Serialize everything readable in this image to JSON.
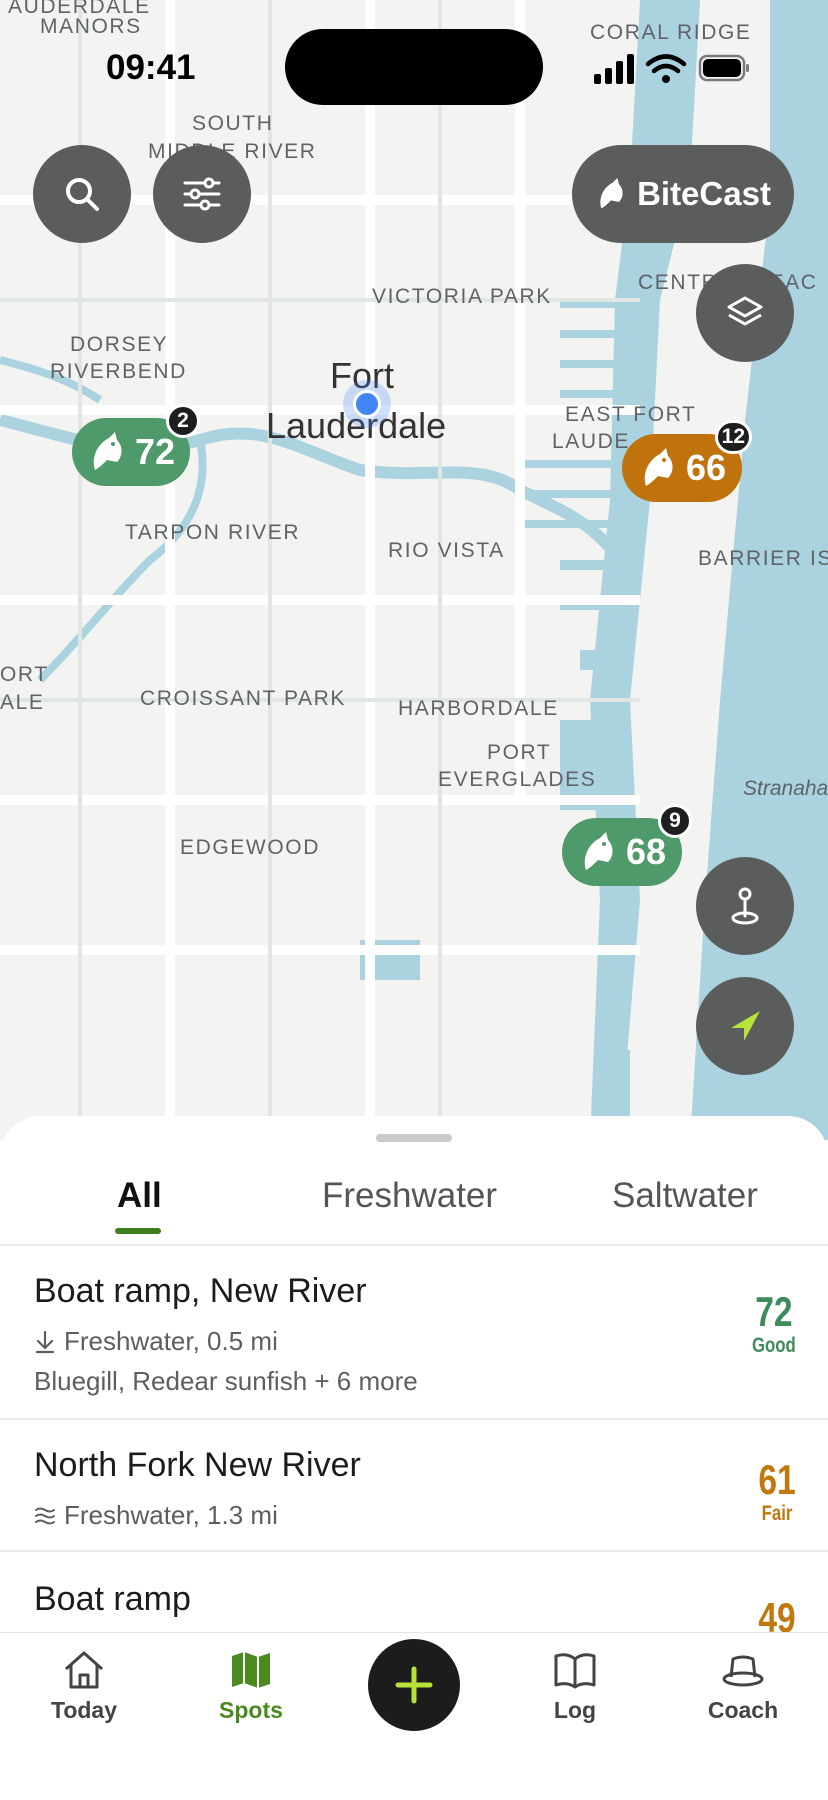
{
  "status": {
    "time": "09:41"
  },
  "map": {
    "labels": [
      {
        "text": "AUDERDALE",
        "cls": ""
      },
      {
        "text": "MANORS",
        "cls": ""
      },
      {
        "text": "SOUTH",
        "cls": ""
      },
      {
        "text": "MIDDLE RIVER",
        "cls": ""
      },
      {
        "text": "CORAL RIDGE",
        "cls": ""
      },
      {
        "text": "VICTORIA PARK",
        "cls": ""
      },
      {
        "text": "CENTRAL BEAC",
        "cls": ""
      },
      {
        "text": "DORSEY",
        "cls": ""
      },
      {
        "text": "RIVERBEND",
        "cls": ""
      },
      {
        "text": "Fort",
        "cls": "big"
      },
      {
        "text": "Lauderdale",
        "cls": "big"
      },
      {
        "text": "EAST FORT",
        "cls": ""
      },
      {
        "text": "LAUDE",
        "cls": ""
      },
      {
        "text": "TARPON RIVER",
        "cls": ""
      },
      {
        "text": "RIO VISTA",
        "cls": ""
      },
      {
        "text": "BARRIER IS",
        "cls": ""
      },
      {
        "text": "ORT",
        "cls": ""
      },
      {
        "text": "ALE",
        "cls": ""
      },
      {
        "text": "CROISSANT PARK",
        "cls": ""
      },
      {
        "text": "HARBORDALE",
        "cls": ""
      },
      {
        "text": "PORT",
        "cls": ""
      },
      {
        "text": "EVERGLADES",
        "cls": ""
      },
      {
        "text": "Stranaha",
        "cls": "italic"
      },
      {
        "text": "EDGEWOOD",
        "cls": ""
      }
    ],
    "markers": [
      {
        "score": "72",
        "count": "2",
        "color": "#4f9a6a"
      },
      {
        "score": "66",
        "count": "12",
        "color": "#c0720c"
      },
      {
        "score": "68",
        "count": "9",
        "color": "#4f9a6a"
      }
    ],
    "bitecast_label": "BiteCast"
  },
  "sheet": {
    "tabs": [
      "All",
      "Freshwater",
      "Saltwater"
    ],
    "spots": [
      {
        "title": "Boat ramp, New River",
        "meta": "Freshwater, 0.5 mi",
        "species": "Bluegill, Redear sunfish + 6 more",
        "score": "72",
        "rating": "Good",
        "color": "#3f8b5c"
      },
      {
        "title": "North Fork New River",
        "meta": "Freshwater, 1.3 mi",
        "species": "",
        "score": "61",
        "rating": "Fair",
        "color": "#c0780f"
      },
      {
        "title": "Boat ramp",
        "meta": "",
        "species": "",
        "score": "49",
        "rating": "",
        "color": "#c0780f"
      }
    ]
  },
  "nav": {
    "items": [
      "Today",
      "Spots",
      "Log",
      "Coach"
    ]
  }
}
